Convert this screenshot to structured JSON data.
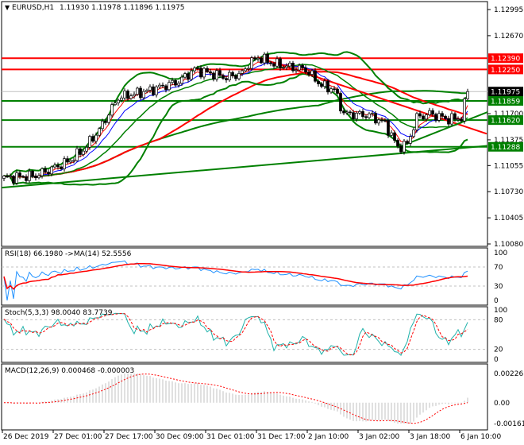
{
  "header": {
    "menu_icon": "triangle-down-icon",
    "symbol": "EURUSD,H1",
    "open": "1.11930",
    "high": "1.11978",
    "low": "1.11896",
    "close": "1.11975"
  },
  "price_axis": {
    "labels": [
      "1.12995",
      "1.12670",
      "1.11700",
      "1.11375",
      "1.11055",
      "1.10730",
      "1.10405",
      "1.10080"
    ],
    "values": [
      1.12995,
      1.1267,
      1.117,
      1.11375,
      1.11055,
      1.1073,
      1.10405,
      1.1008
    ],
    "range": [
      1.1008,
      1.12995
    ]
  },
  "levels": [
    {
      "label": "1.12390",
      "value": 1.1239,
      "color": "#ff0000"
    },
    {
      "label": "1.12250",
      "value": 1.1225,
      "color": "#ff0000"
    },
    {
      "label": "1.11975",
      "value": 1.11975,
      "color": "#000000",
      "line": "#c0c0c0"
    },
    {
      "label": "1.11859",
      "value": 1.11859,
      "color": "#008000"
    },
    {
      "label": "1.11620",
      "value": 1.1162,
      "color": "#008000"
    },
    {
      "label": "1.11288",
      "value": 1.11288,
      "color": "#008000"
    }
  ],
  "rsi": {
    "label": "RSI(18) 66.1980  ->MA(14) 52.5556",
    "levels": [
      "100",
      "70",
      "30",
      "0"
    ],
    "line_color": "#1e90ff",
    "ma_color": "#ff0000"
  },
  "stoch": {
    "label": "Stoch(5,3,3) 98.0040 83.7739",
    "levels": [
      "100",
      "80",
      "20",
      "0"
    ],
    "main_color": "#20b2aa",
    "signal_color": "#ff0000"
  },
  "macd": {
    "label": "MACD(12,26,9) 0.000468 -0.000003",
    "levels": [
      "0.002261",
      "0.00",
      "-0.001614"
    ],
    "range": [
      -0.001614,
      0.002261
    ],
    "hist_color": "#c0c0c0",
    "signal_color": "#ff0000"
  },
  "time_axis": {
    "labels": [
      "26 Dec 2019",
      "27 Dec 01:00",
      "27 Dec 17:00",
      "30 Dec 09:00",
      "31 Dec 01:00",
      "31 Dec 17:00",
      "2 Jan 10:00",
      "3 Jan 02:00",
      "3 Jan 18:00",
      "6 Jan 10:00"
    ]
  },
  "chart_data": {
    "type": "candlestick",
    "timeframe": "H1",
    "bars": 147,
    "key_points": [
      [
        0,
        1.109
      ],
      [
        10,
        1.1093
      ],
      [
        20,
        1.111
      ],
      [
        25,
        1.1125
      ],
      [
        30,
        1.115
      ],
      [
        36,
        1.119
      ],
      [
        45,
        1.1198
      ],
      [
        55,
        1.121
      ],
      [
        60,
        1.1225
      ],
      [
        70,
        1.1215
      ],
      [
        75,
        1.122
      ],
      [
        77,
        1.1232
      ],
      [
        80,
        1.124
      ],
      [
        85,
        1.1232
      ],
      [
        90,
        1.1228
      ],
      [
        95,
        1.1225
      ],
      [
        100,
        1.1205
      ],
      [
        104,
        1.12
      ],
      [
        107,
        1.117
      ],
      [
        115,
        1.1168
      ],
      [
        120,
        1.1158
      ],
      [
        124,
        1.1128
      ],
      [
        127,
        1.1132
      ],
      [
        130,
        1.1165
      ],
      [
        134,
        1.117
      ],
      [
        140,
        1.1163
      ],
      [
        144,
        1.1165
      ],
      [
        146,
        1.11975
      ]
    ],
    "trendlines": [
      {
        "color": "#ff0000",
        "from": [
          80,
          1.124
        ],
        "to": [
          152,
          1.1145
        ]
      }
    ]
  }
}
